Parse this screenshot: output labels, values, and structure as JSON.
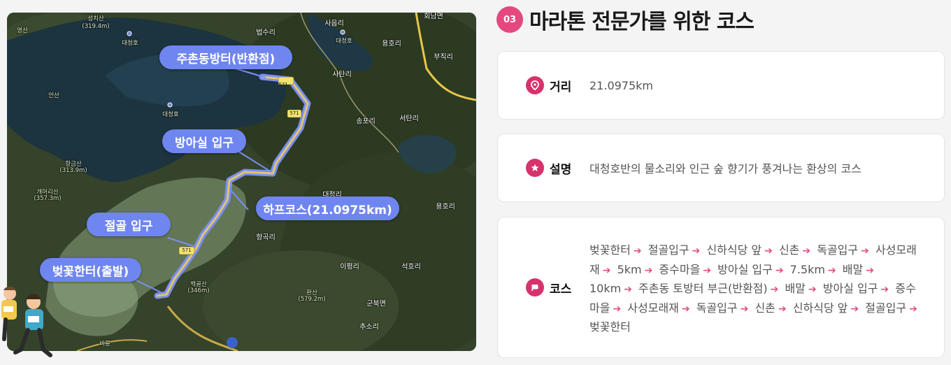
{
  "map": {
    "route_badge": "571",
    "callouts": {
      "turnaround": "주촌동방터(반환점)",
      "bangasil": "방아실 입구",
      "half_course": "하프코스(21.0975km)",
      "jeolgol": "절골 입구",
      "start": "벚꽃한터(출발)"
    },
    "places": {
      "seongchisan": "성치산",
      "seongchisan_h": "(319.4m)",
      "daecheongho_1": "대청호",
      "daecheongho_2": "대청호",
      "daecheongho_3": "대청호",
      "beopsuri": "법수리",
      "saeumri": "사음리",
      "yonghori_1": "용호리",
      "jikjaeri": "부직리",
      "satanri": "사탄리",
      "songpori": "송포리",
      "seotanri": "서탄리",
      "yeongsan": "영산",
      "ansan": "안산",
      "hanggeumsan": "항금산",
      "hanggeumsan_h": "(313.9m)",
      "gaemeorisan": "개머리산",
      "gaemeorisan_h": "(357.3m)",
      "daejeongri": "대정리",
      "yonghori_2": "용호리",
      "hanggokri": "항곡리",
      "iphyeongri": "이평리",
      "seokhori": "석호리",
      "baekgolsan": "백골산",
      "baekgolsan_h": "(346m)",
      "hwansan": "환산",
      "hwansan_h": "(579.2m)",
      "gunbungmyeon": "군북면",
      "chusori": "추소리",
      "birung": "비룡",
      "hoenammyeon": "회남면"
    }
  },
  "section": {
    "number": "03",
    "title": "마라톤 전문가를 위한 코스"
  },
  "cards": {
    "distance": {
      "icon": "location-pin-icon",
      "label": "거리",
      "value": "21.0975km"
    },
    "description": {
      "icon": "star-icon",
      "label": "설명",
      "value": "대청호반의 물소리와 인근 숲 향기가 풍겨나는 환상의 코스"
    },
    "course": {
      "icon": "flag-icon",
      "label": "코스",
      "items": [
        "벚꽃한터",
        "절골입구",
        "신하식당 앞",
        "신촌",
        "독골입구",
        "사성모래재",
        "5km",
        "증수마을",
        "방아실 입구",
        "7.5km",
        "배말",
        "10km",
        "주촌동 토방터 부근(반환점)",
        "배말",
        "방아실 입구",
        "증수마을",
        "사성모래재",
        "독골입구",
        "신촌",
        "신하식당 앞",
        "절골입구",
        "벚꽃한터"
      ]
    }
  },
  "colors": {
    "accent": "#e5487f",
    "callout": "#6f86f0",
    "route": "#7b8ff5"
  }
}
